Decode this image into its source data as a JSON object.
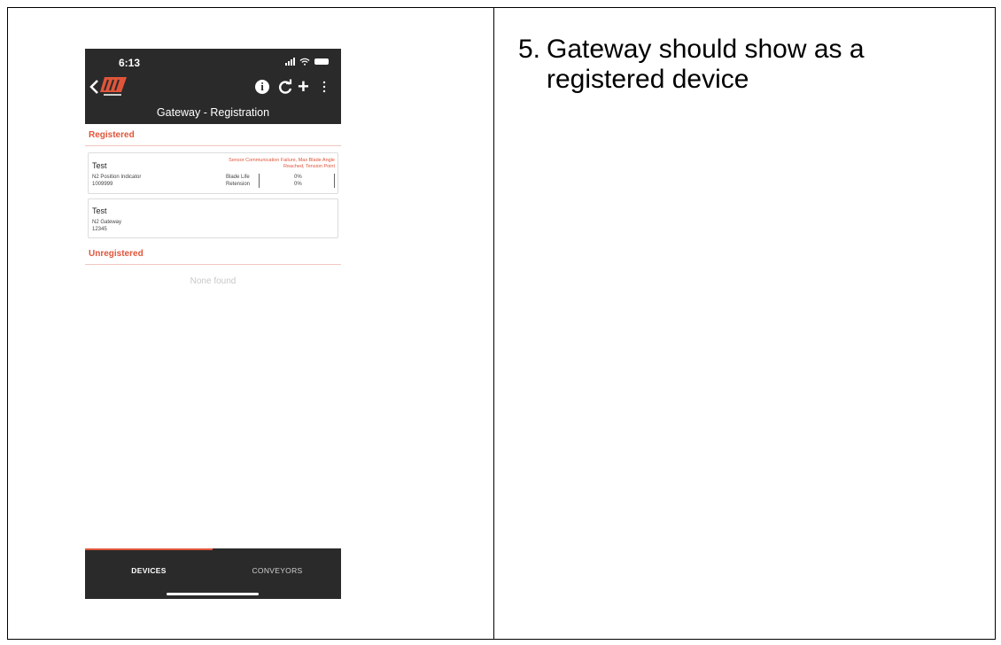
{
  "phone": {
    "status_time": "6:13",
    "logo_text": "martin",
    "page_title": "Gateway - Registration",
    "sections": {
      "registered": "Registered",
      "unregistered": "Unregistered"
    },
    "devices": [
      {
        "name": "Test",
        "type": "N2 Position Indicator",
        "serial": "1009999",
        "alert": "Sensor Communication Failure, Max Blade Angle Reached, Tension Point",
        "metrics": [
          {
            "label": "Blade Life",
            "value": "0%"
          },
          {
            "label": "Retension",
            "value": "0%"
          }
        ]
      },
      {
        "name": "Test",
        "type": "N2 Gateway",
        "serial": "12345"
      }
    ],
    "empty_state": "None found",
    "tabs": {
      "devices": "DEVICES",
      "conveyors": "CONVEYORS"
    },
    "icons": [
      "back-icon",
      "info-icon",
      "refresh-icon",
      "add-icon",
      "more-icon",
      "signal-icon",
      "wifi-icon",
      "battery-icon"
    ],
    "colors": {
      "accent": "#e0553a",
      "appbar": "#2a2a2a"
    }
  },
  "step": {
    "number": "5.",
    "text": "Gateway should show as a\nregistered  device"
  }
}
